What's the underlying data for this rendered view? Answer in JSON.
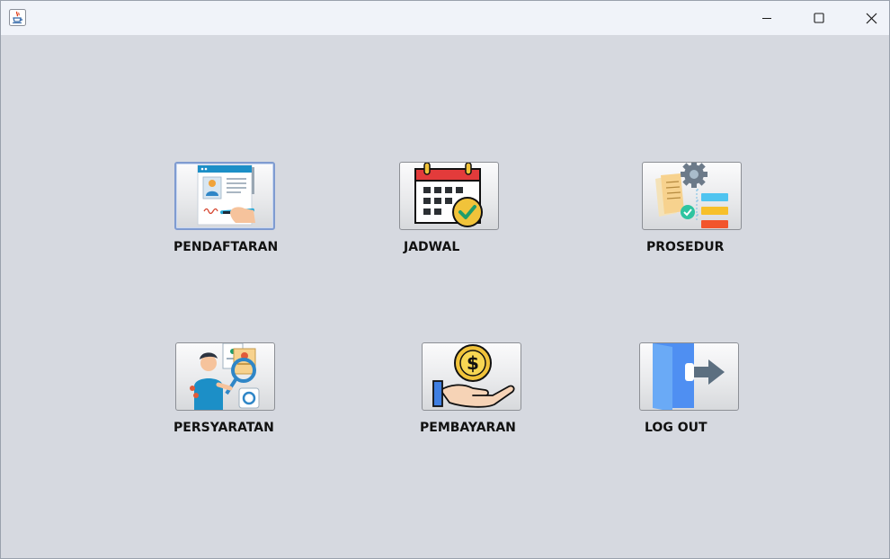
{
  "window": {
    "title": "",
    "controls": {
      "minimize_icon": "minimize-icon",
      "maximize_icon": "maximize-icon",
      "close_icon": "close-icon"
    },
    "background": "#d6d9e0"
  },
  "menu": {
    "items": [
      {
        "label": "PENDAFTARAN",
        "icon": "registration-form-icon"
      },
      {
        "label": "JADWAL",
        "icon": "calendar-check-icon"
      },
      {
        "label": "PROSEDUR",
        "icon": "procedure-workflow-icon"
      },
      {
        "label": "PERSYARATAN",
        "icon": "requirements-documents-icon"
      },
      {
        "label": "PEMBAYARAN",
        "icon": "payment-coin-hand-icon"
      },
      {
        "label": "LOG OUT",
        "icon": "logout-door-icon"
      }
    ]
  }
}
